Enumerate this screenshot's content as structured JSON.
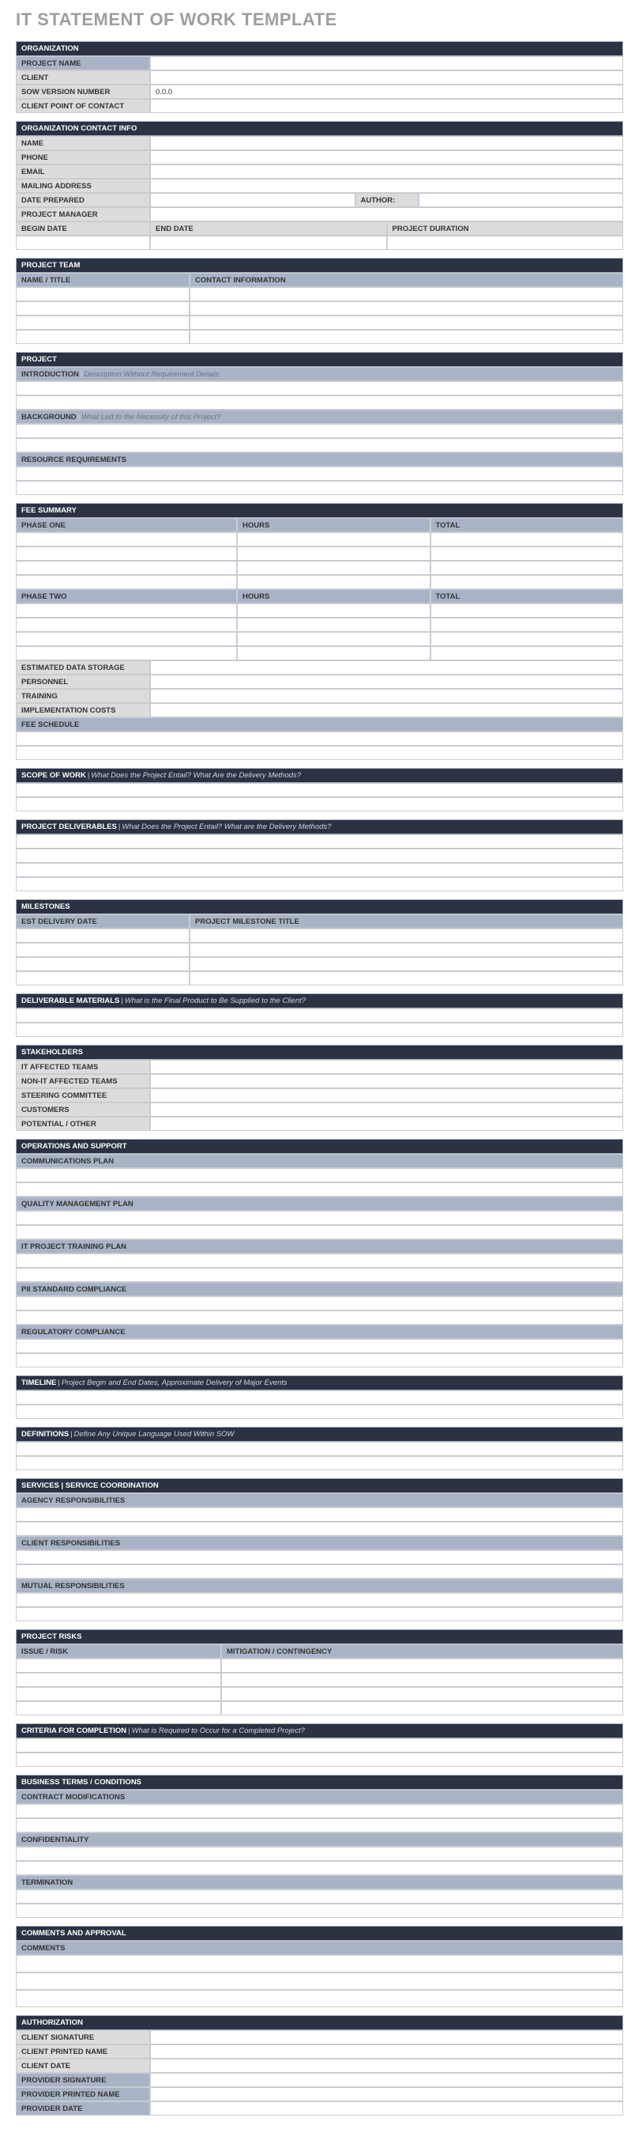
{
  "title": "IT STATEMENT OF WORK TEMPLATE",
  "org": {
    "header": "ORGANIZATION",
    "projectName": "PROJECT NAME",
    "client": "CLIENT",
    "sowVersion": "SOW VERSION NUMBER",
    "sowVersionVal": "0.0.0",
    "poc": "CLIENT POINT OF CONTACT"
  },
  "contact": {
    "header": "ORGANIZATION CONTACT INFO",
    "name": "NAME",
    "phone": "PHONE",
    "email": "EMAIL",
    "mailing": "MAILING ADDRESS",
    "datePrepared": "DATE PREPARED",
    "author": "AUTHOR:",
    "pm": "PROJECT MANAGER",
    "begin": "BEGIN DATE",
    "end": "END DATE",
    "duration": "PROJECT DURATION"
  },
  "team": {
    "header": "PROJECT TEAM",
    "colName": "NAME / TITLE",
    "colContact": "CONTACT INFORMATION"
  },
  "project": {
    "header": "PROJECT",
    "intro": "INTRODUCTION",
    "introHint": "Description Without Requirement Details",
    "bg": "BACKGROUND",
    "bgHint": "What Led to the Necessity of this Project?",
    "resource": "RESOURCE REQUIREMENTS"
  },
  "fee": {
    "header": "FEE SUMMARY",
    "phase1": "PHASE ONE",
    "phase2": "PHASE TWO",
    "hours": "HOURS",
    "total": "TOTAL",
    "storage": "ESTIMATED DATA STORAGE",
    "personnel": "PERSONNEL",
    "training": "TRAINING",
    "impl": "IMPLEMENTATION COSTS",
    "schedule": "FEE SCHEDULE"
  },
  "scope": {
    "header": "SCOPE OF WORK",
    "hint": "What Does the Project Entail? What Are the Delivery Methods?"
  },
  "deliv": {
    "header": "PROJECT DELIVERABLES",
    "hint": "What Does the Project Entail? What are the Delivery Methods?"
  },
  "milestones": {
    "header": "MILESTONES",
    "colDate": "EST DELIVERY DATE",
    "colTitle": "PROJECT MILESTONE TITLE"
  },
  "delivMat": {
    "header": "DELIVERABLE MATERIALS",
    "hint": "What is the Final Product to Be Supplied to the Client?"
  },
  "stake": {
    "header": "STAKEHOLDERS",
    "it": "IT AFFECTED TEAMS",
    "nonit": "NON-IT AFFECTED TEAMS",
    "steering": "STEERING COMMITTEE",
    "customers": "CUSTOMERS",
    "potential": "POTENTIAL / OTHER"
  },
  "ops": {
    "header": "OPERATIONS AND SUPPORT",
    "comm": "COMMUNICATIONS PLAN",
    "quality": "QUALITY MANAGEMENT PLAN",
    "training": "IT PROJECT TRAINING PLAN",
    "pii": "PII STANDARD COMPLIANCE",
    "reg": "REGULATORY COMPLIANCE"
  },
  "timeline": {
    "header": "TIMELINE",
    "hint": "Project Begin and End Dates, Approximate Delivery of Major Events"
  },
  "defs": {
    "header": "DEFINITIONS",
    "hint": "Define Any Unique Language Used Within SOW"
  },
  "services": {
    "header": "SERVICES | SERVICE COORDINATION",
    "agency": "AGENCY RESPONSIBILITIES",
    "client": "CLIENT RESPONSIBILITIES",
    "mutual": "MUTUAL RESPONSIBILITIES"
  },
  "risks": {
    "header": "PROJECT RISKS",
    "colIssue": "ISSUE / RISK",
    "colMit": "MITIGATION / CONTINGENCY"
  },
  "criteria": {
    "header": "CRITERIA FOR COMPLETION",
    "hint": "What is Required to Occur for a Completed Project?"
  },
  "terms": {
    "header": "BUSINESS TERMS / CONDITIONS",
    "contract": "CONTRACT MODIFICATIONS",
    "conf": "CONFIDENTIALITY",
    "term": "TERMINATION"
  },
  "comments": {
    "header": "COMMENTS AND APPROVAL",
    "label": "COMMENTS"
  },
  "auth": {
    "header": "AUTHORIZATION",
    "csig": "CLIENT SIGNATURE",
    "cname": "CLIENT PRINTED NAME",
    "cdate": "CLIENT DATE",
    "psig": "PROVIDER SIGNATURE",
    "pname": "PROVIDER PRINTED NAME",
    "pdate": "PROVIDER DATE"
  }
}
